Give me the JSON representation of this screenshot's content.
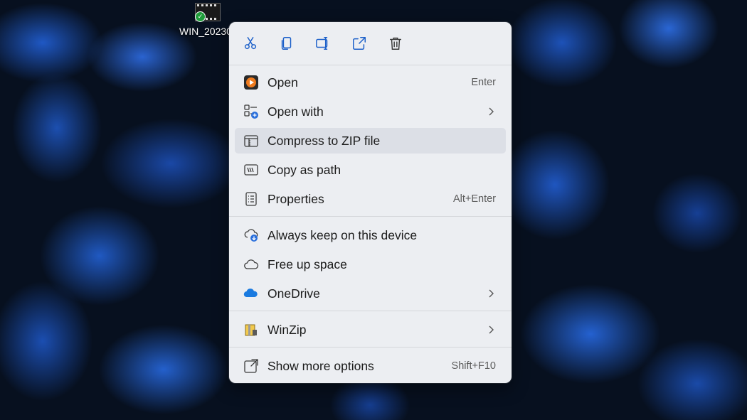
{
  "desktop": {
    "file_icon_label": "WIN_20230"
  },
  "toolbar": {
    "buttons": [
      {
        "name": "cut",
        "icon": "scissors-icon"
      },
      {
        "name": "copy",
        "icon": "copy-icon"
      },
      {
        "name": "rename",
        "icon": "rename-icon"
      },
      {
        "name": "share",
        "icon": "share-icon"
      },
      {
        "name": "delete",
        "icon": "trash-icon"
      }
    ]
  },
  "menu": {
    "items": [
      {
        "label": "Open",
        "shortcut": "Enter",
        "icon": "media-player-icon"
      },
      {
        "label": "Open with",
        "shortcut": "",
        "icon": "open-with-icon",
        "submenu": true
      },
      {
        "label": "Compress to ZIP file",
        "shortcut": "",
        "icon": "zip-folder-icon",
        "highlighted": true
      },
      {
        "label": "Copy as path",
        "shortcut": "",
        "icon": "copy-path-icon"
      },
      {
        "label": "Properties",
        "shortcut": "Alt+Enter",
        "icon": "properties-icon"
      },
      {
        "label": "Always keep on this device",
        "shortcut": "",
        "icon": "cloud-keep-icon"
      },
      {
        "label": "Free up space",
        "shortcut": "",
        "icon": "cloud-outline-icon"
      },
      {
        "label": "OneDrive",
        "shortcut": "",
        "icon": "onedrive-icon",
        "submenu": true
      },
      {
        "label": "WinZip",
        "shortcut": "",
        "icon": "winzip-icon",
        "submenu": true
      },
      {
        "label": "Show more options",
        "shortcut": "Shift+F10",
        "icon": "show-more-icon"
      }
    ]
  },
  "colors": {
    "menu_background": "#eceef2",
    "highlight": "#dcdfe6",
    "accent": "#2a6fdb",
    "onedrive_blue": "#1a7ae0"
  }
}
